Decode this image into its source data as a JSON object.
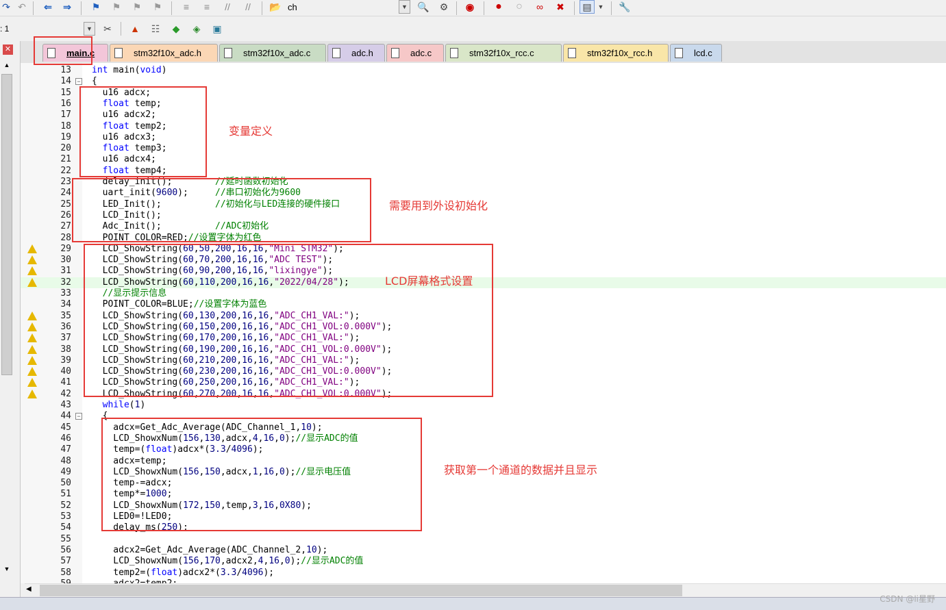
{
  "toolbar": {
    "find_text": "ch",
    "target_text": ": 1"
  },
  "tabs": [
    {
      "label": "main.c",
      "color": "#f3c6d9"
    },
    {
      "label": "stm32f10x_adc.h",
      "color": "#fbd7b5"
    },
    {
      "label": "stm32f10x_adc.c",
      "color": "#c9dcc4"
    },
    {
      "label": "adc.h",
      "color": "#d6cde8"
    },
    {
      "label": "adc.c",
      "color": "#f6c8c8"
    },
    {
      "label": "stm32f10x_rcc.c",
      "color": "#d9e6c8"
    },
    {
      "label": "stm32f10x_rcc.h",
      "color": "#f9e6a8"
    },
    {
      "label": "lcd.c",
      "color": "#c9d9ec"
    }
  ],
  "lines": [
    {
      "n": "13",
      "html": "<span class='kw'>int</span> main(<span class='kw'>void</span>)"
    },
    {
      "n": "14",
      "html": "{"
    },
    {
      "n": "15",
      "html": "  u16 adcx;"
    },
    {
      "n": "16",
      "html": "  <span class='kw'>float</span> temp;"
    },
    {
      "n": "17",
      "html": "  u16 adcx2;"
    },
    {
      "n": "18",
      "html": "  <span class='kw'>float</span> temp2;"
    },
    {
      "n": "19",
      "html": "  u16 adcx3;"
    },
    {
      "n": "20",
      "html": "  <span class='kw'>float</span> temp3;"
    },
    {
      "n": "21",
      "html": "  u16 adcx4;"
    },
    {
      "n": "22",
      "html": "  <span class='kw'>float</span> temp4;"
    },
    {
      "n": "23",
      "html": "  delay_init();        <span class='cm'>//延时函数初始化</span>"
    },
    {
      "n": "24",
      "html": "  uart_init(<span class='num'>9600</span>);     <span class='cm'>//串口初始化为9600</span>"
    },
    {
      "n": "25",
      "html": "  LED_Init();          <span class='cm'>//初始化与LED连接的硬件接口</span>"
    },
    {
      "n": "26",
      "html": "  LCD_Init();"
    },
    {
      "n": "27",
      "html": "  Adc_Init();          <span class='cm'>//ADC初始化</span>"
    },
    {
      "n": "28",
      "html": "  POINT_COLOR=RED;<span class='cm'>//设置字体为红色</span>"
    },
    {
      "n": "29",
      "html": "  LCD_ShowString(<span class='num'>60</span>,<span class='num'>50</span>,<span class='num'>200</span>,<span class='num'>16</span>,<span class='num'>16</span>,<span class='str'>\"Mini STM32\"</span>);"
    },
    {
      "n": "30",
      "html": "  LCD_ShowString(<span class='num'>60</span>,<span class='num'>70</span>,<span class='num'>200</span>,<span class='num'>16</span>,<span class='num'>16</span>,<span class='str'>\"ADC TEST\"</span>);"
    },
    {
      "n": "31",
      "html": "  LCD_ShowString(<span class='num'>60</span>,<span class='num'>90</span>,<span class='num'>200</span>,<span class='num'>16</span>,<span class='num'>16</span>,<span class='str'>\"lixingye\"</span>);"
    },
    {
      "n": "32",
      "html": "  LCD_ShowString(<span class='num'>60</span>,<span class='num'>110</span>,<span class='num'>200</span>,<span class='num'>16</span>,<span class='num'>16</span>,<span class='str'>\"2022/04/28\"</span>);"
    },
    {
      "n": "33",
      "html": "  <span class='cm'>//显示提示信息</span>"
    },
    {
      "n": "34",
      "html": "  POINT_COLOR=BLUE;<span class='cm'>//设置字体为蓝色</span>"
    },
    {
      "n": "35",
      "html": "  LCD_ShowString(<span class='num'>60</span>,<span class='num'>130</span>,<span class='num'>200</span>,<span class='num'>16</span>,<span class='num'>16</span>,<span class='str'>\"ADC_CH1_VAL:\"</span>);"
    },
    {
      "n": "36",
      "html": "  LCD_ShowString(<span class='num'>60</span>,<span class='num'>150</span>,<span class='num'>200</span>,<span class='num'>16</span>,<span class='num'>16</span>,<span class='str'>\"ADC_CH1_VOL:0.000V\"</span>);"
    },
    {
      "n": "37",
      "html": "  LCD_ShowString(<span class='num'>60</span>,<span class='num'>170</span>,<span class='num'>200</span>,<span class='num'>16</span>,<span class='num'>16</span>,<span class='str'>\"ADC_CH1_VAL:\"</span>);"
    },
    {
      "n": "38",
      "html": "  LCD_ShowString(<span class='num'>60</span>,<span class='num'>190</span>,<span class='num'>200</span>,<span class='num'>16</span>,<span class='num'>16</span>,<span class='str'>\"ADC_CH1_VOL:0.000V\"</span>);"
    },
    {
      "n": "39",
      "html": "  LCD_ShowString(<span class='num'>60</span>,<span class='num'>210</span>,<span class='num'>200</span>,<span class='num'>16</span>,<span class='num'>16</span>,<span class='str'>\"ADC_CH1_VAL:\"</span>);"
    },
    {
      "n": "40",
      "html": "  LCD_ShowString(<span class='num'>60</span>,<span class='num'>230</span>,<span class='num'>200</span>,<span class='num'>16</span>,<span class='num'>16</span>,<span class='str'>\"ADC_CH1_VOL:0.000V\"</span>);"
    },
    {
      "n": "41",
      "html": "  LCD_ShowString(<span class='num'>60</span>,<span class='num'>250</span>,<span class='num'>200</span>,<span class='num'>16</span>,<span class='num'>16</span>,<span class='str'>\"ADC_CH1_VAL:\"</span>);"
    },
    {
      "n": "42",
      "html": "  LCD_ShowString(<span class='num'>60</span>,<span class='num'>270</span>,<span class='num'>200</span>,<span class='num'>16</span>,<span class='num'>16</span>,<span class='str'>\"ADC_CH1_VOL:0.000V\"</span>);"
    },
    {
      "n": "43",
      "html": "  <span class='kw'>while</span>(<span class='num'>1</span>)"
    },
    {
      "n": "44",
      "html": "  {"
    },
    {
      "n": "45",
      "html": "    adcx=Get_Adc_Average(ADC_Channel_1,<span class='num'>10</span>);"
    },
    {
      "n": "46",
      "html": "    LCD_ShowxNum(<span class='num'>156</span>,<span class='num'>130</span>,adcx,<span class='num'>4</span>,<span class='num'>16</span>,<span class='num'>0</span>);<span class='cm'>//显示ADC的值</span>"
    },
    {
      "n": "47",
      "html": "    temp=(<span class='kw'>float</span>)adcx*(<span class='num'>3.3</span>/<span class='num'>4096</span>);"
    },
    {
      "n": "48",
      "html": "    adcx=temp;"
    },
    {
      "n": "49",
      "html": "    LCD_ShowxNum(<span class='num'>156</span>,<span class='num'>150</span>,adcx,<span class='num'>1</span>,<span class='num'>16</span>,<span class='num'>0</span>);<span class='cm'>//显示电压值</span>"
    },
    {
      "n": "50",
      "html": "    temp-=adcx;"
    },
    {
      "n": "51",
      "html": "    temp*=<span class='num'>1000</span>;"
    },
    {
      "n": "52",
      "html": "    LCD_ShowxNum(<span class='num'>172</span>,<span class='num'>150</span>,temp,<span class='num'>3</span>,<span class='num'>16</span>,<span class='num'>0X80</span>);"
    },
    {
      "n": "53",
      "html": "    LED0=!LED0;"
    },
    {
      "n": "54",
      "html": "    delay_ms(<span class='num'>250</span>);"
    },
    {
      "n": "55",
      "html": ""
    },
    {
      "n": "56",
      "html": "    adcx2=Get_Adc_Average(ADC_Channel_2,<span class='num'>10</span>);"
    },
    {
      "n": "57",
      "html": "    LCD_ShowxNum(<span class='num'>156</span>,<span class='num'>170</span>,adcx2,<span class='num'>4</span>,<span class='num'>16</span>,<span class='num'>0</span>);<span class='cm'>//显示ADC的值</span>"
    },
    {
      "n": "58",
      "html": "    temp2=(<span class='kw'>float</span>)adcx2*(<span class='num'>3.3</span>/<span class='num'>4096</span>);"
    },
    {
      "n": "59",
      "html": "    adcx2=temp2;"
    }
  ],
  "warnings": [
    "29",
    "30",
    "31",
    "32",
    "35",
    "36",
    "37",
    "38",
    "39",
    "40",
    "41",
    "42"
  ],
  "annotations": {
    "vars": "变量定义",
    "periph": "需要用到外设初始化",
    "lcd": "LCD屏幕格式设置",
    "ch1": "获取第一个通道的数据并且显示"
  },
  "watermark": "CSDN @li星野",
  "colors": {
    "annotation": "#e53935",
    "current_line": "#e8fbe8"
  }
}
